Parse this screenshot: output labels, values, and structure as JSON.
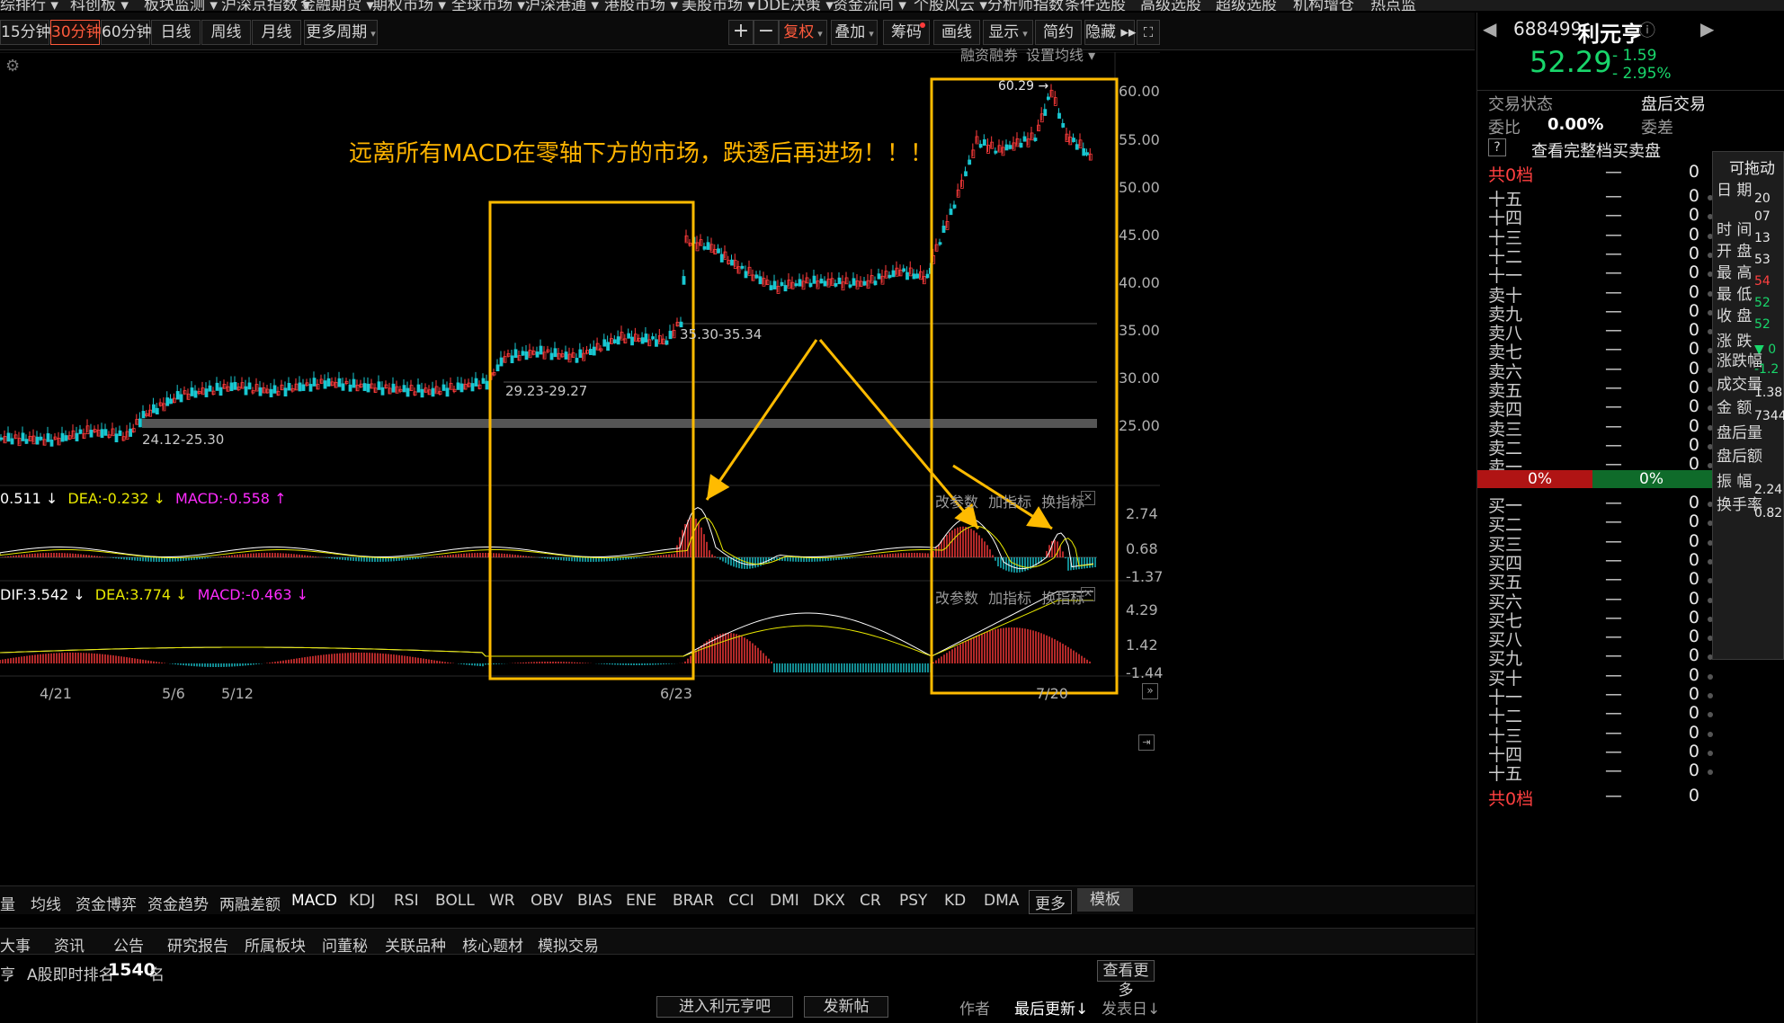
{
  "top_menu": [
    "综排行 ▾",
    "科创板 ▾",
    "板块监测 ▾",
    "沪深京指数 ▾",
    "金融期货 ▾",
    "期权市场 ▾",
    "全球市场 ▾",
    "沪深港通 ▾",
    "港股市场 ▾",
    "美股市场 ▾",
    "DDE决策 ▾",
    "资金流向 ▾",
    "个股风云 ▾",
    "分析师指数",
    "条件选股",
    "高级选股",
    "超级选股",
    "机构增仓",
    "热点监"
  ],
  "periods": [
    "15分钟",
    "30分钟",
    "60分钟",
    "日线",
    "周线",
    "月线"
  ],
  "active_period": "30分钟",
  "more_periods": "更多周期",
  "toolbar_right": {
    "plus": "+",
    "minus": "−",
    "fuquan": "复权",
    "diejia": "叠加",
    "chouma": "筹码",
    "huaxian": "画线",
    "xianshi": "显示",
    "jiancao": "简约",
    "yincang": "隐藏 ▸▸"
  },
  "chart_tools": {
    "rzrq": "融资融券",
    "sz_junxian": "设置均线"
  },
  "price_axis": [
    "60.00",
    "55.00",
    "50.00",
    "45.00",
    "40.00",
    "35.00",
    "30.00",
    "25.00"
  ],
  "price_annotations": {
    "high": "60.29",
    "support1": "24.12-25.30",
    "support2": "29.23-29.27",
    "support3": "35.30-35.34"
  },
  "note": "远离所有MACD在零轴下方的市场，跌透后再进场！！！",
  "macd1": {
    "dif": "0.511 ↓",
    "dea": "DEA:-0.232 ↓",
    "macd": "MACD:-0.558 ↑",
    "axis": [
      "2.74",
      "0.68",
      "-1.37"
    ],
    "actions": [
      "改参数",
      "加指标",
      "换指标"
    ]
  },
  "macd2": {
    "dif": "DIF:3.542 ↓",
    "dea": "DEA:3.774 ↓",
    "macd": "MACD:-0.463 ↓",
    "axis": [
      "4.29",
      "1.42",
      "-1.44"
    ],
    "actions": [
      "改参数",
      "加指标",
      "换指标"
    ]
  },
  "date_axis": [
    "4/21",
    "5/6",
    "5/12",
    "6/23",
    "7/20"
  ],
  "indicator_tabs": [
    "量",
    "均线",
    "资金博弈",
    "资金趋势",
    "两融差额",
    "MACD",
    "KDJ",
    "RSI",
    "BOLL",
    "WR",
    "OBV",
    "BIAS",
    "ENE",
    "BRAR",
    "CCI",
    "DMI",
    "DKX",
    "CR",
    "PSY",
    "KD",
    "DMA",
    "更多",
    "模板"
  ],
  "selected_indicator": "MACD",
  "news_tabs": [
    "大事",
    "资讯",
    "公告",
    "研究报告",
    "所属板块",
    "问董秘",
    "关联品种",
    "核心题材",
    "模拟交易"
  ],
  "rank": {
    "prefix": "亨",
    "label": "A股即时排名",
    "value": "1540",
    "suffix": "名",
    "more": "查看更多"
  },
  "bottom": {
    "enter": "进入利元亨吧",
    "post": "发新帖",
    "author": "作者",
    "updated": "最后更新↓",
    "posted": "发表日↓"
  },
  "stock": {
    "code": "688499",
    "name": "利元亨",
    "price": "52.29",
    "change": "- 1.59",
    "change_pct": "- 2.95%",
    "trade_status_label": "交易状态",
    "trade_status": "盘后交易",
    "weibi_label": "委比",
    "weibi": "0.00%",
    "weicha_label": "委差",
    "full_book": "查看完整档买卖盘",
    "help": "?",
    "total_top_label": "共0档",
    "total_bottom_label": "共0档",
    "sell_ratio": "0%",
    "buy_ratio": "0%"
  },
  "sell_levels": [
    "十五",
    "十四",
    "十三",
    "十二",
    "十一",
    "卖十",
    "卖九",
    "卖八",
    "卖七",
    "卖六",
    "卖五",
    "卖四",
    "卖三",
    "卖二",
    "卖一"
  ],
  "buy_levels": [
    "买一",
    "买二",
    "买三",
    "买四",
    "买五",
    "买六",
    "买七",
    "买八",
    "买九",
    "买十",
    "十一",
    "十二",
    "十三",
    "十四",
    "十五"
  ],
  "level_dash": "—",
  "level_vol": "0",
  "popup": {
    "title": "可拖动",
    "rows": [
      {
        "label": "日 期",
        "value": "20"
      },
      {
        "label": "",
        "value": "07"
      },
      {
        "label": "时 间",
        "value": "13"
      },
      {
        "label": "开 盘",
        "value": "53"
      },
      {
        "label": "最 高",
        "value": "54"
      },
      {
        "label": "最 低",
        "value": "52"
      },
      {
        "label": "收 盘",
        "value": "52"
      },
      {
        "label": "涨 跌",
        "value": "▼ 0"
      },
      {
        "label": "涨跌幅",
        "value": "-1.2"
      },
      {
        "label": "成交量",
        "value": "1.38"
      },
      {
        "label": "金 额",
        "value": "7344"
      },
      {
        "label": "盘后量",
        "value": ""
      },
      {
        "label": "盘后额",
        "value": ""
      },
      {
        "label": "振 幅",
        "value": "2.24"
      },
      {
        "label": "换手率",
        "value": "0.82"
      }
    ]
  },
  "colors": {
    "up": "#ff3b3b",
    "down": "#19c7d1",
    "box": "#ffbb00",
    "dea": "#e8e800",
    "macd_label": "#ff2bff",
    "price_green": "#19d66b"
  }
}
